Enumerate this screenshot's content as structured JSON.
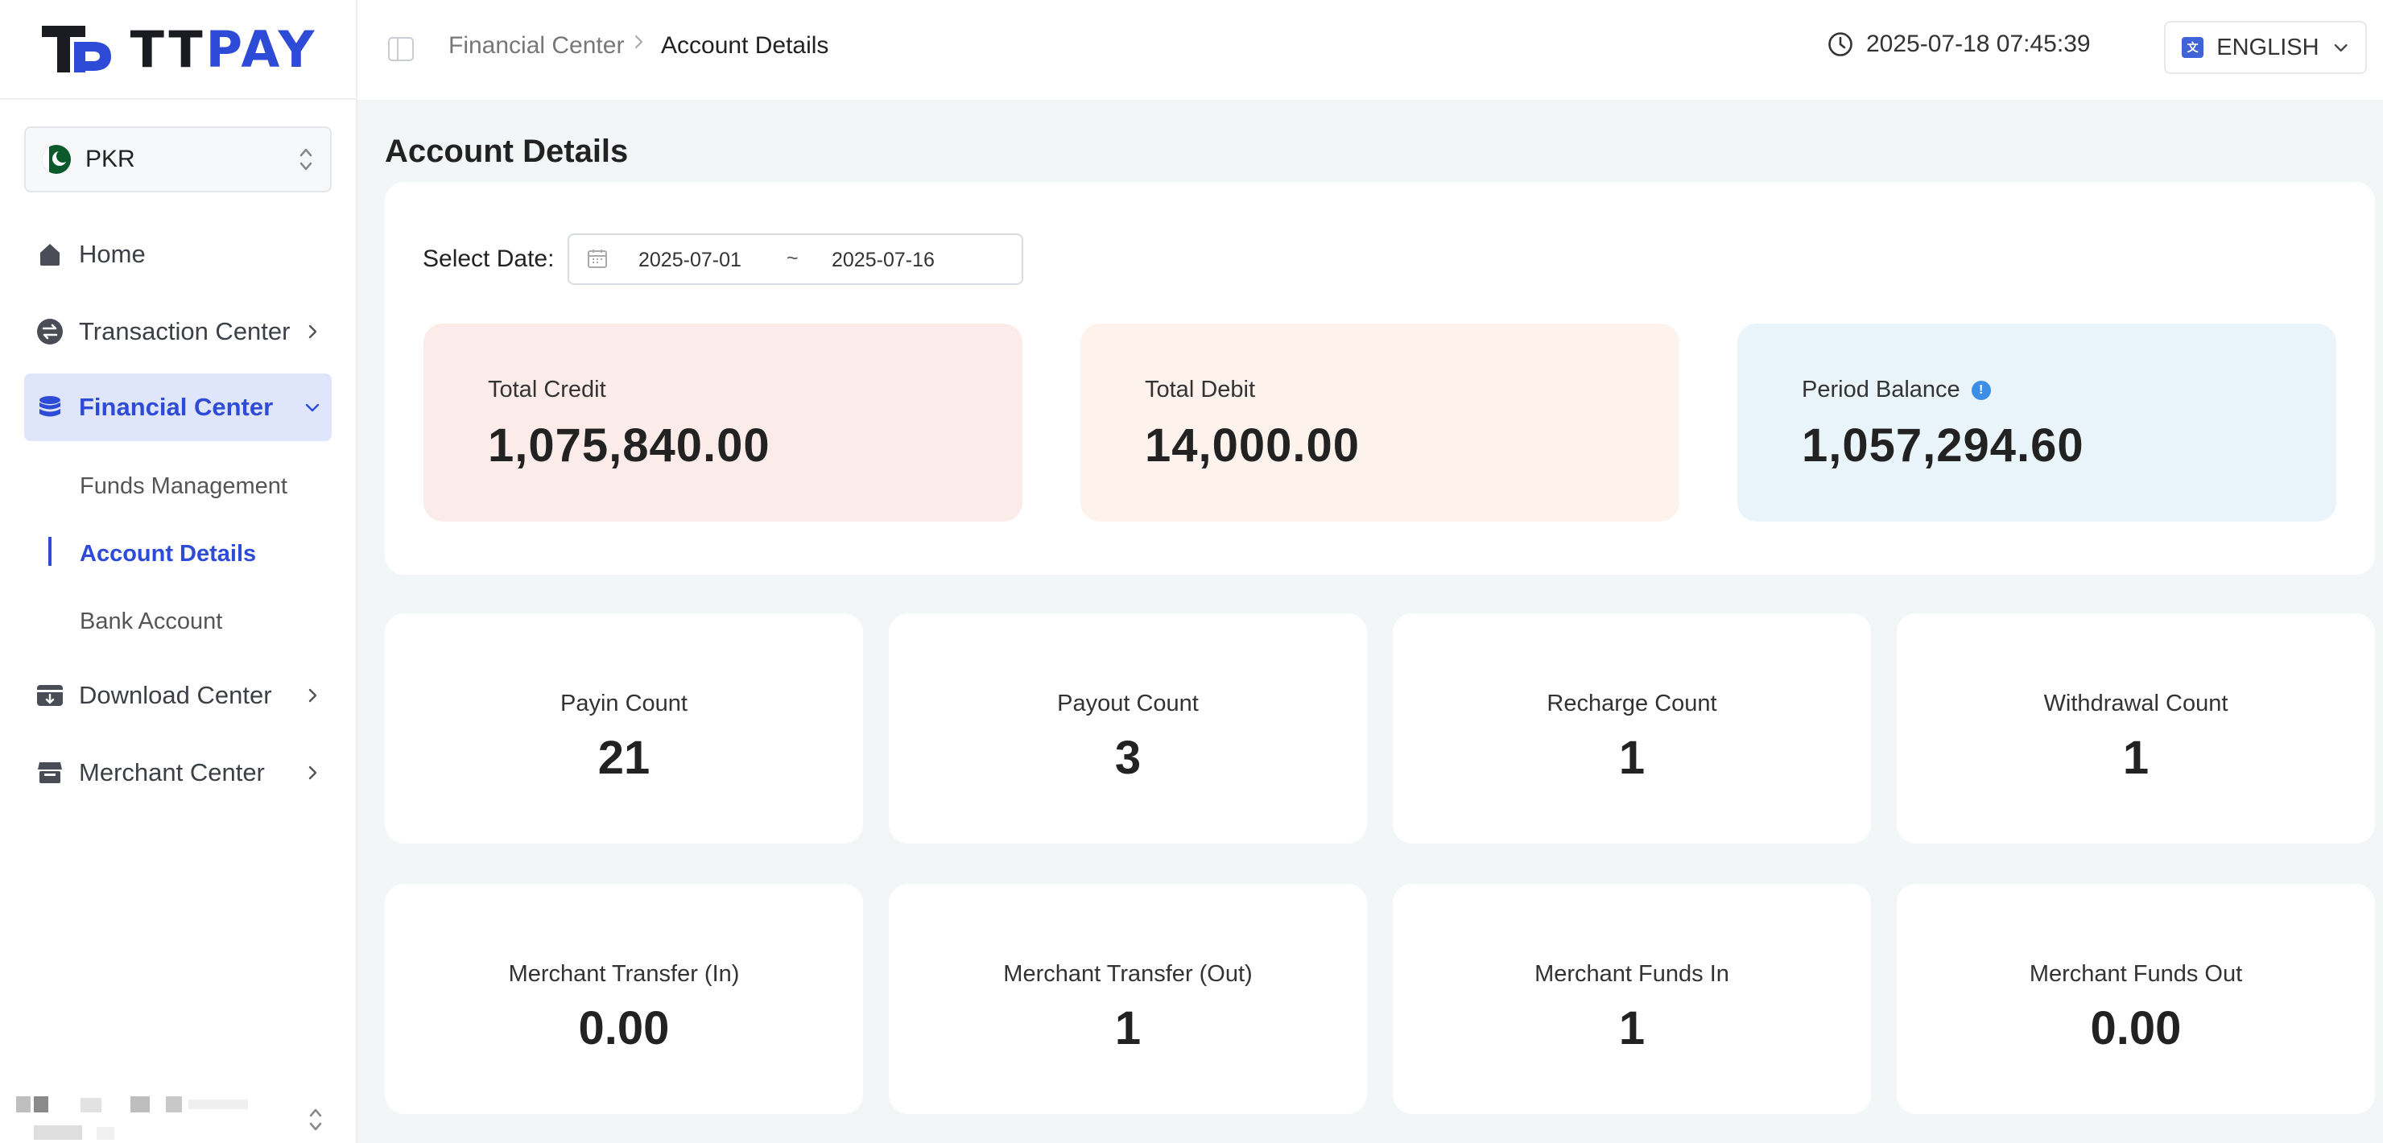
{
  "app": {
    "logo_left": "TT",
    "logo_right": "PAY",
    "brand_color": "#2d4bd6"
  },
  "sidebar": {
    "currency": "PKR",
    "items": [
      {
        "label": "Home",
        "icon": "home-icon"
      },
      {
        "label": "Transaction Center",
        "icon": "exchange-icon"
      },
      {
        "label": "Financial Center",
        "icon": "database-icon",
        "expanded": true
      },
      {
        "label": "Download Center",
        "icon": "download-icon"
      },
      {
        "label": "Merchant Center",
        "icon": "store-icon"
      }
    ],
    "submenu": [
      {
        "label": "Funds Management"
      },
      {
        "label": "Account Details",
        "active": true
      },
      {
        "label": "Bank Account"
      }
    ]
  },
  "header": {
    "breadcrumb": [
      "Financial Center",
      "Account Details"
    ],
    "datetime": "2025-07-18 07:45:39",
    "language": "ENGLISH"
  },
  "main": {
    "title": "Account Details",
    "date_filter": {
      "label": "Select Date:",
      "start": "2025-07-01",
      "separator": "~",
      "end": "2025-07-16"
    },
    "summary": [
      {
        "label": "Total Credit",
        "value": "1,075,840.00",
        "color": "#fbecea"
      },
      {
        "label": "Total Debit",
        "value": "14,000.00",
        "color": "#fdf3ec"
      },
      {
        "label": "Period Balance",
        "value": "1,057,294.60",
        "color": "#eaf4fb"
      }
    ],
    "counts": [
      {
        "label": "Payin Count",
        "value": "21"
      },
      {
        "label": "Payout Count",
        "value": "3"
      },
      {
        "label": "Recharge Count",
        "value": "1"
      },
      {
        "label": "Withdrawal Count",
        "value": "1"
      },
      {
        "label": "Merchant Transfer (In)",
        "value": "0.00"
      },
      {
        "label": "Merchant Transfer (Out)",
        "value": "1"
      },
      {
        "label": "Merchant Funds In",
        "value": "1"
      },
      {
        "label": "Merchant Funds Out",
        "value": "0.00"
      }
    ]
  }
}
